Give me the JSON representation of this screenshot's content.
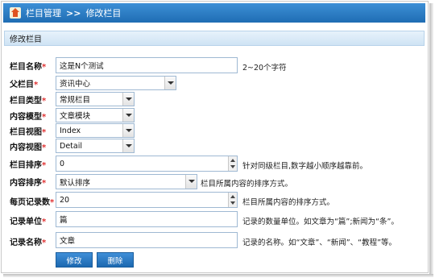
{
  "breadcrumb": {
    "root": "栏目管理",
    "sep": ">>",
    "current": "修改栏目"
  },
  "section_title": "修改栏目",
  "fields": {
    "name": {
      "label": "栏目名称",
      "value": "这是N个测试",
      "hint": "2~20个字符"
    },
    "parent": {
      "label": "父栏目",
      "value": "资讯中心"
    },
    "type": {
      "label": "栏目类型",
      "value": "常规栏目"
    },
    "content_model": {
      "label": "内容模型",
      "value": "文章模块"
    },
    "column_view": {
      "label": "栏目视图",
      "value": "Index"
    },
    "content_view": {
      "label": "内容视图",
      "value": "Detail"
    },
    "sort": {
      "label": "栏目排序",
      "value": "0",
      "hint": "针对同级栏目,数字越小顺序越靠前。"
    },
    "content_sort": {
      "label": "内容排序",
      "value": "默认排序",
      "hint": "栏目所属内容的排序方式。"
    },
    "page_size": {
      "label": "每页记录数",
      "value": "20",
      "hint": "栏目所属内容的排序方式。"
    },
    "record_unit": {
      "label": "记录单位",
      "value": "篇",
      "hint": "记录的数量单位。如文章为“篇”;新闻为“条”。"
    },
    "record_name": {
      "label": "记录名称",
      "value": "文章",
      "hint": "记录的名称。如“文章”、“新闻”、“教程”等。"
    }
  },
  "required_mark": "*",
  "buttons": {
    "edit": "修改",
    "delete": "删除"
  },
  "colors": {
    "header_blue": "#1f6db3",
    "required_red": "#e03030"
  }
}
